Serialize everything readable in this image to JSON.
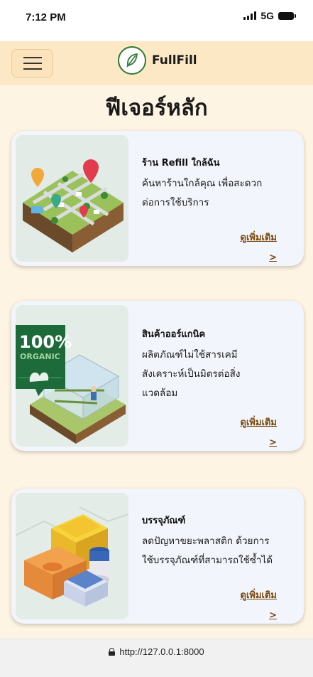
{
  "status_bar": {
    "time": "7:12 PM",
    "network": "5G",
    "icons": [
      "signal-icon",
      "battery-icon"
    ]
  },
  "header": {
    "menu_icon": "hamburger-menu-icon",
    "logo_icon": "leaf-feather-icon",
    "brand": "FullFill"
  },
  "page": {
    "title": "ฟีเจอร์หลัก"
  },
  "features": [
    {
      "title": "ร้าน Refill ใกล้ฉัน",
      "description_lines": [
        "ค้นหาร้านใกล้คุณ เพื่อสะดวก",
        "ต่อการใช้บริการ"
      ],
      "more_label": "ดูเพิ่มเติม",
      "arrow_label": ">",
      "image": "isometric-city-map-with-location-pins"
    },
    {
      "title": "สินค้าออร์แกนิค",
      "description_lines": [
        "ผลิตภัณฑ์ไม่ใช้สารเคมี",
        "สังเคราะห์เป็นมิตรต่อสิ่ง",
        "แวดล้อม"
      ],
      "badge_line1": "100%",
      "badge_line2": "ORGANIC",
      "more_label": "ดูเพิ่มเติม",
      "arrow_label": ">",
      "image": "organic-greenhouse-farm"
    },
    {
      "title": "บรรจุภัณฑ์",
      "description_lines": [
        "ลดปัญหาขยะพลาสติก ด้วยการ",
        "ใช้บรรจุภัณฑ์ที่สามารถใช้ซ้ำได้"
      ],
      "more_label": "ดูเพิ่มเติม",
      "arrow_label": ">",
      "image": "reusable-food-containers"
    }
  ],
  "browser": {
    "url": "http://127.0.0.1:8000",
    "lock_icon": "lock-icon"
  },
  "colors": {
    "page_background": "#fef4e4",
    "header_background": "#fde8c6",
    "card_background": "#f2f5fb",
    "link_color": "#7a4a10",
    "brand_green": "#2f7a36"
  }
}
